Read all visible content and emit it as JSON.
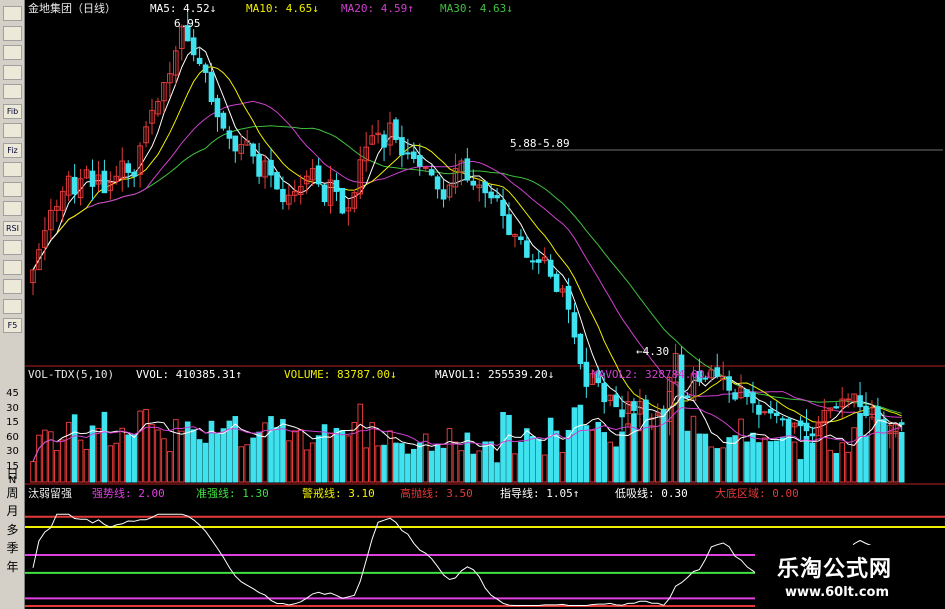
{
  "toolbar": {
    "buttons": [
      "icon-1",
      "icon-2",
      "icon-3",
      "icon-4",
      "icon-5",
      "Fib",
      "icon-7",
      "Fiz",
      "icon-9",
      "icon-10",
      "icon-11",
      "RSI",
      "icon-13",
      "icon-14",
      "icon-15",
      "icon-16",
      "F5"
    ],
    "periods": [
      "日",
      "周",
      "月",
      "多",
      "季",
      "年"
    ]
  },
  "main_header": {
    "stock": "金地集团（日线）",
    "ma5": "MA5: 4.52↓",
    "ma10": "MA10: 4.65↓",
    "ma20": "MA20: 4.59↑",
    "ma30": "MA30: 4.63↓",
    "high_label": "6.95",
    "mid_label": "5.88-5.89",
    "low_label": "←4.30"
  },
  "vol_header": {
    "name": "VOL-TDX(5,10)",
    "vvol": "VVOL: 410385.31↑",
    "volume": "VOLUME: 83787.00↓",
    "mavol1": "MAVOL1: 255539.20↓",
    "mavol2": "MAVOL2: 328784.00↓"
  },
  "vol_axis": [
    "45",
    "30",
    "15",
    "60",
    "30",
    "15",
    "N"
  ],
  "ind_header": {
    "name": "汰弱留强",
    "line1": "强势线: 2.00",
    "line2": "准强线: 1.30",
    "line3": "警戒线: 3.10",
    "line4": "高抛线: 3.50",
    "line5": "指导线: 1.05↑",
    "line6": "低吸线: 0.30",
    "line7": "大底区域: 0.00"
  },
  "colors": {
    "up": "#e23a3a",
    "down": "#3fe3ef",
    "ma5": "#ffffff",
    "ma10": "#f0f000",
    "ma20": "#d040d0",
    "ma30": "#40c040"
  },
  "chart_data": {
    "type": "candlestick",
    "close": [
      4.98,
      5.14,
      5.29,
      5.45,
      5.48,
      5.6,
      5.72,
      5.58,
      5.7,
      5.77,
      5.64,
      5.73,
      5.59,
      5.67,
      5.72,
      5.84,
      5.75,
      5.72,
      5.96,
      6.11,
      6.24,
      6.31,
      6.46,
      6.53,
      6.71,
      6.9,
      6.79,
      6.68,
      6.61,
      6.54,
      6.31,
      6.19,
      6.1,
      6.02,
      5.92,
      5.97,
      6.0,
      5.88,
      5.72,
      5.84,
      5.73,
      5.62,
      5.52,
      5.57,
      5.6,
      5.64,
      5.72,
      5.78,
      5.66,
      5.52,
      5.69,
      5.6,
      5.43,
      5.47,
      5.59,
      5.85,
      5.95,
      6.04,
      6.06,
      5.95,
      6.14,
      6.01,
      5.89,
      5.9,
      5.86,
      5.8,
      5.79,
      5.73,
      5.62,
      5.54,
      5.65,
      5.78,
      5.84,
      5.69,
      5.65,
      5.65,
      5.59,
      5.55,
      5.55,
      5.41,
      5.26,
      5.26,
      5.22,
      5.08,
      5.05,
      5.04,
      5.08,
      4.93,
      4.81,
      4.83,
      4.67,
      4.45,
      4.24,
      4.06,
      4.16,
      4.09,
      3.94,
      3.99,
      3.9,
      3.82,
      3.94,
      3.87,
      3.94,
      3.82,
      3.81,
      3.85,
      3.77,
      4.13,
      4.32,
      3.97,
      3.97,
      4.16,
      4.1,
      4.12,
      4.19,
      4.14,
      4.14,
      4.03,
      3.96,
      4.05,
      3.98,
      3.93,
      3.84,
      3.86,
      3.85,
      3.83,
      3.8,
      3.74,
      3.77,
      3.75,
      3.71,
      3.67,
      3.78,
      3.87,
      3.89,
      3.89,
      3.96,
      3.96,
      4.0,
      3.9,
      3.83,
      3.89,
      3.77,
      3.7,
      3.7,
      3.76,
      3.76
    ]
  }
}
